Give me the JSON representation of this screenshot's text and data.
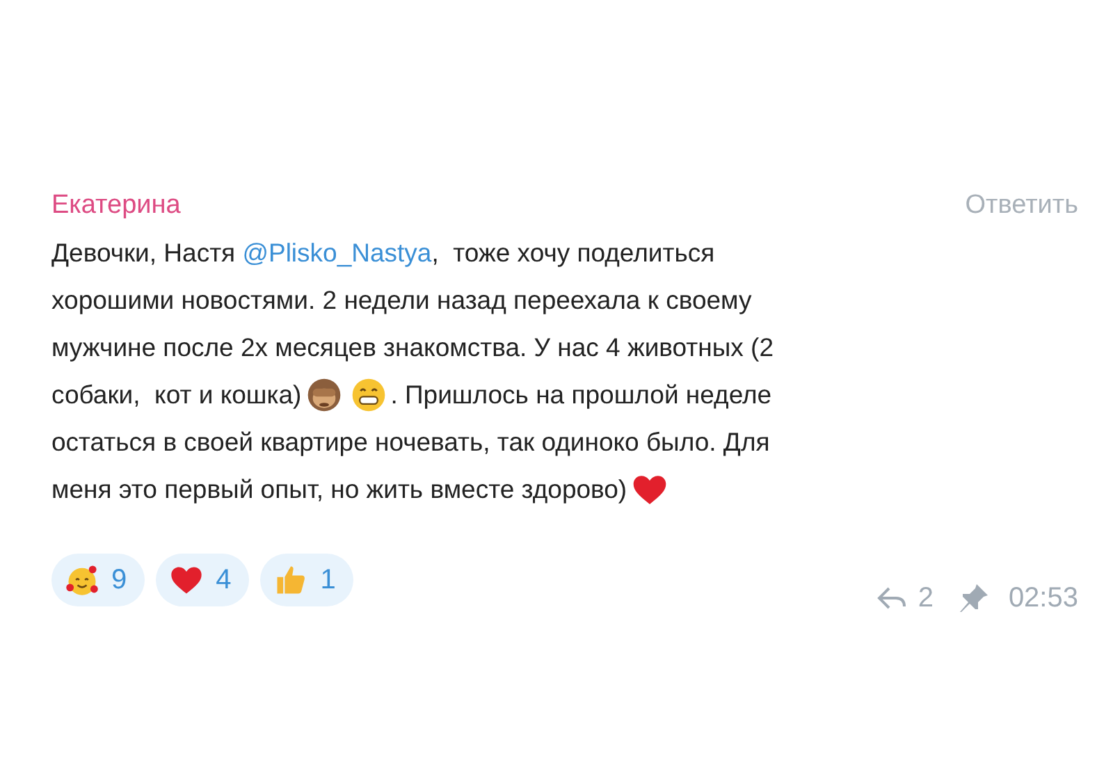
{
  "message": {
    "author": "Екатерина",
    "reply_label": "Ответить",
    "lines": [
      {
        "segments": [
          {
            "kind": "text",
            "text": "Девочки, Настя "
          },
          {
            "kind": "mention",
            "text": "@Plisko_Nastya"
          },
          {
            "kind": "text",
            "text": ",  тоже хочу поделиться"
          }
        ]
      },
      {
        "segments": [
          {
            "kind": "text",
            "text": "хорошими новостями. 2 недели назад переехала к своему"
          }
        ]
      },
      {
        "segments": [
          {
            "kind": "text",
            "text": "мужчине после 2х месяцев знакомства. У нас 4 животных (2"
          }
        ]
      },
      {
        "segments": [
          {
            "kind": "text",
            "text": "собаки,  кот и кошка)"
          },
          {
            "kind": "monkey"
          },
          {
            "kind": "grin"
          },
          {
            "kind": "text",
            "text": ". Пришлось на прошлой неделе"
          }
        ]
      },
      {
        "segments": [
          {
            "kind": "text",
            "text": "остаться в своей квартире ночевать, так одиноко было. Для"
          }
        ]
      },
      {
        "segments": [
          {
            "kind": "text",
            "text": "меня это первый опыт, но жить вместе здорово)"
          },
          {
            "kind": "heart"
          }
        ]
      }
    ],
    "reactions": [
      {
        "kind": "hearts_face",
        "count": "9"
      },
      {
        "kind": "heart",
        "count": "4"
      },
      {
        "kind": "thumbs_up",
        "count": "1"
      }
    ],
    "replies": "2",
    "time": "02:53"
  }
}
